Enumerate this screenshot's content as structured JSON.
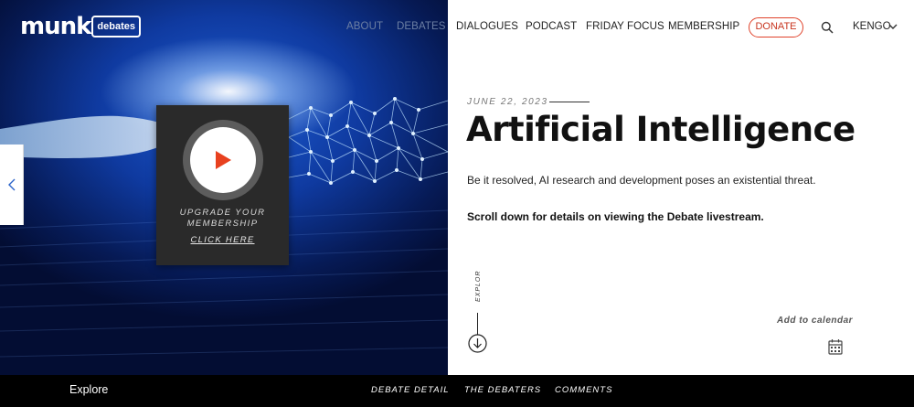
{
  "header": {
    "logo_word": "munk",
    "logo_box": "debates",
    "nav": [
      "ABOUT",
      "DEBATES",
      "DIALOGUES",
      "PODCAST",
      "FRIDAY FOCUS",
      "MEMBERSHIP"
    ],
    "donate": "DONATE",
    "user": "KENGO"
  },
  "video": {
    "upgrade_text": "UPGRADE YOUR MEMBERSHIP",
    "click_here": "CLICK HERE"
  },
  "debate": {
    "date": "JUNE 22, 2023",
    "title": "Artificial Intelligence",
    "resolution": "Be it resolved, AI research and development poses an existential threat.",
    "scroll_note": "Scroll down for details on viewing the Debate livestream."
  },
  "explore_vertical": "EXPLORE",
  "add_to_calendar": "Add to calendar",
  "bottom_bar": {
    "explore": "Explore",
    "tabs": [
      "DEBATE DETAIL",
      "THE DEBATERS",
      "COMMENTS"
    ]
  },
  "colors": {
    "donate_border": "#e0432b",
    "play_icon": "#e8411f",
    "hero_blue": "#0f3aa0",
    "bottom_bar": "#000000"
  },
  "icons": [
    "play-icon",
    "search-icon",
    "chevron-down-icon",
    "chevron-left-icon",
    "arrow-down-circle-icon",
    "calendar-icon"
  ]
}
